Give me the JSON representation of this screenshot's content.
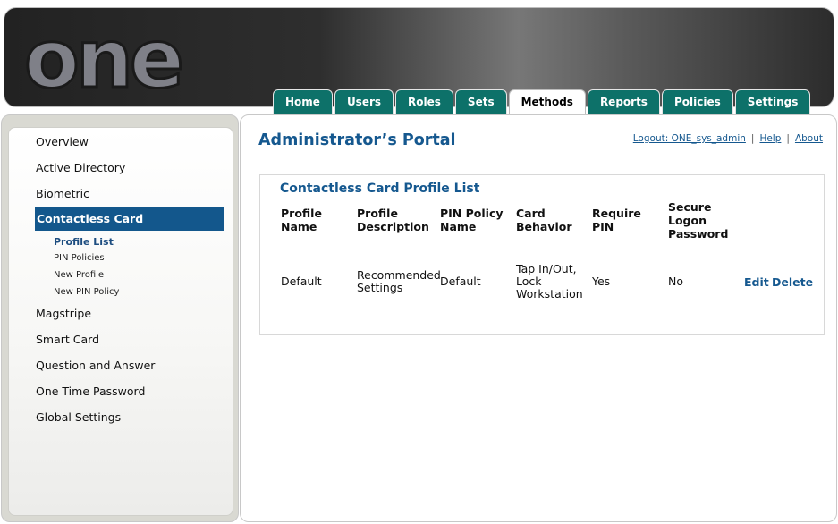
{
  "header": {
    "logo_text": "one",
    "tabs": [
      {
        "label": "Home"
      },
      {
        "label": "Users"
      },
      {
        "label": "Roles"
      },
      {
        "label": "Sets"
      },
      {
        "label": "Methods",
        "active": true
      },
      {
        "label": "Reports"
      },
      {
        "label": "Policies"
      },
      {
        "label": "Settings"
      }
    ]
  },
  "sidebar": {
    "items": [
      {
        "label": "Overview"
      },
      {
        "label": "Active Directory"
      },
      {
        "label": "Biometric"
      },
      {
        "label": "Contactless Card",
        "selected": true
      },
      {
        "label": "Magstripe"
      },
      {
        "label": "Smart Card"
      },
      {
        "label": "Question and Answer"
      },
      {
        "label": "One Time Password"
      },
      {
        "label": "Global Settings"
      }
    ],
    "subitems": [
      {
        "label": "Profile List",
        "current": true
      },
      {
        "label": "PIN Policies"
      },
      {
        "label": "New Profile"
      },
      {
        "label": "New PIN Policy"
      }
    ]
  },
  "main": {
    "title": "Administrator’s Portal",
    "links": {
      "logout": "Logout: ONE_sys_admin",
      "help": "Help",
      "about": "About",
      "separator": "|"
    },
    "list": {
      "title": "Contactless Card Profile List",
      "headers": [
        "Profile Name",
        "Profile Description",
        "PIN Policy Name",
        "Card Behavior",
        "Require PIN",
        "Secure Logon Password"
      ],
      "rows": [
        {
          "profile_name": "Default",
          "description": "Recommended Settings",
          "pin_policy": "Default",
          "card_behavior": "Tap In/Out, Lock Workstation",
          "require_pin": "Yes",
          "secure_logon": "No",
          "edit_label": "Edit",
          "delete_label": "Delete"
        }
      ]
    }
  },
  "colors": {
    "tab_bg": "#0d7169",
    "accent_blue": "#15588f",
    "selected_nav_bg": "#13578c"
  }
}
